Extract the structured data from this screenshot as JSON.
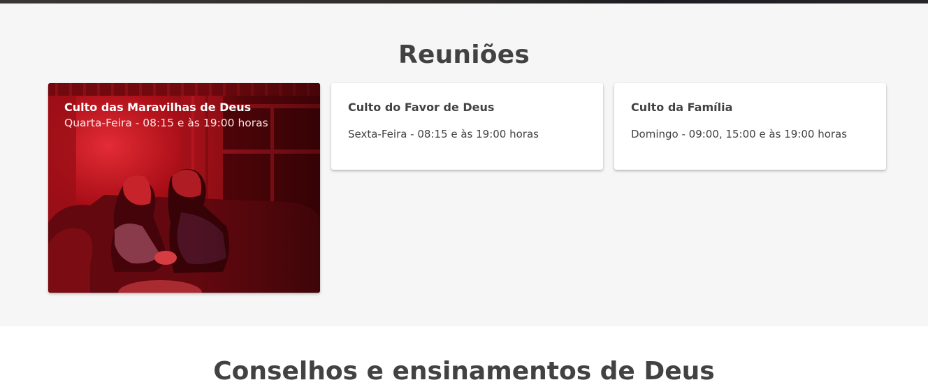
{
  "section": {
    "title": "Reuniões"
  },
  "meetings": [
    {
      "title": "Culto das Maravilhas de Deus",
      "schedule": "Quarta-Feira - 08:15 e às 19:00 horas",
      "image_icon": "people-praying-photo"
    },
    {
      "title": "Culto do Favor de Deus",
      "schedule": "Sexta-Feira - 08:15 e às 19:00 horas"
    },
    {
      "title": "Culto da Família",
      "schedule": "Domingo - 09:00, 15:00 e às 19:00 horas"
    }
  ],
  "next_section": {
    "title": "Conselhos e ensinamentos de Deus"
  },
  "colors": {
    "section_bg": "#f6f6f6",
    "text": "#424242",
    "photo_tint": "#c0141e"
  }
}
